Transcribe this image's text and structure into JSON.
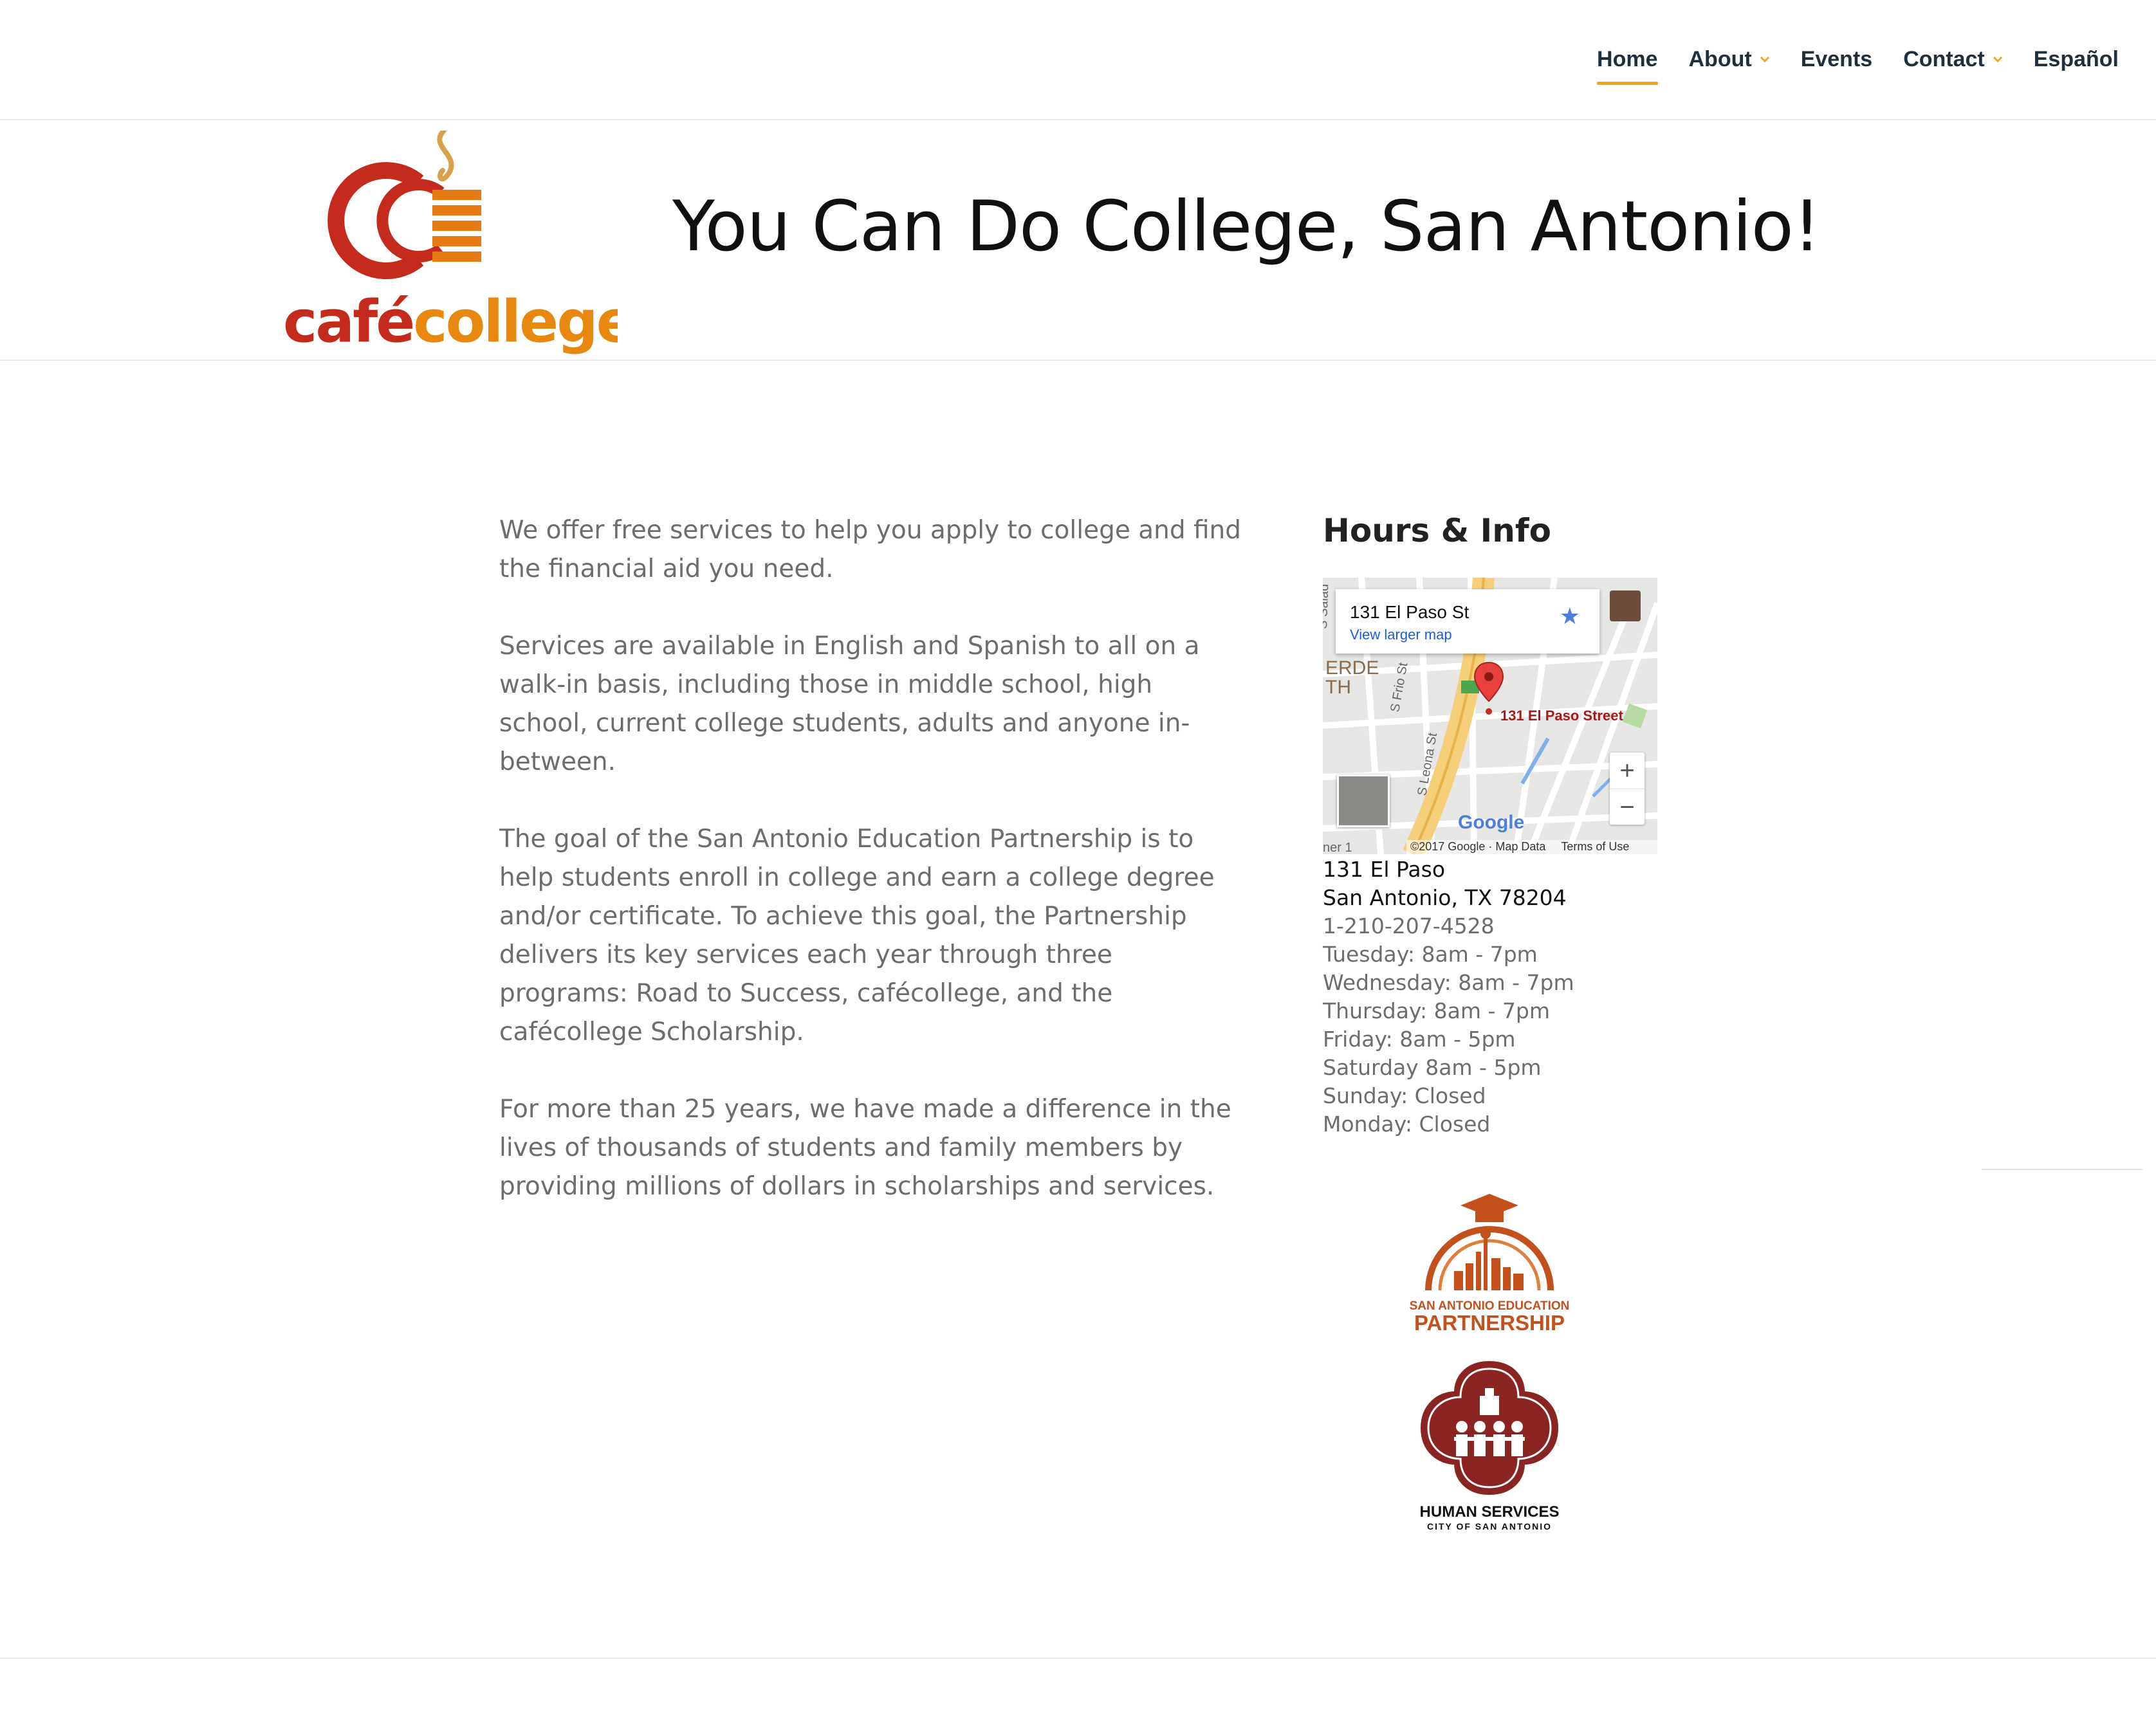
{
  "nav": {
    "items": [
      {
        "label": "Home",
        "active": true,
        "dropdown": false
      },
      {
        "label": "About",
        "active": false,
        "dropdown": true
      },
      {
        "label": "Events",
        "active": false,
        "dropdown": false
      },
      {
        "label": "Contact",
        "active": false,
        "dropdown": true
      },
      {
        "label": "Español",
        "active": false,
        "dropdown": false
      }
    ],
    "accent_color": "#f2a71b"
  },
  "header": {
    "logo_text_cafe": "café",
    "logo_text_college": "college",
    "tagline": "You Can Do College, San Antonio!"
  },
  "main": {
    "paragraphs": [
      "We offer free services to help you apply to college and find the financial aid you need.",
      "Services are available in English and Spanish to all on a walk-in basis, including those in middle school, high school, current college students, adults and anyone in-between.",
      "The goal of the San Antonio Education Partnership is to help students enroll in college and earn a college degree and/or certificate. To achieve this goal, the Partnership delivers its key services each year through three programs: Road to Success, cafécollege, and the cafécollege Scholarship.",
      "For more than 25 years, we have made a difference in the lives of thousands of students and family members by providing millions of dollars in scholarships and services."
    ]
  },
  "sidebar": {
    "title": "Hours & Info",
    "map": {
      "card_title": "131 El Paso St",
      "card_link": "View larger map",
      "pin_label": "131 El Paso Street",
      "google_label": "Google",
      "copyright": "©2017 Google · Map Data",
      "terms": "Terms of Use",
      "zoom_in": "+",
      "zoom_out": "−"
    },
    "address_line1": "131 El Paso",
    "address_line2": "San Antonio, TX 78204",
    "phone": "1-210-207-4528",
    "hours": [
      "Tuesday: 8am - 7pm",
      "Wednesday: 8am - 7pm",
      "Thursday: 8am - 7pm",
      "Friday: 8am - 5pm",
      "Saturday 8am - 5pm",
      "Sunday: Closed",
      "Monday: Closed"
    ]
  },
  "partners": {
    "saep_line1": "SAN ANTONIO EDUCATION",
    "saep_line2": "PARTNERSHIP",
    "hs_line1": "HUMAN SERVICES",
    "hs_line2": "CITY OF SAN ANTONIO"
  }
}
